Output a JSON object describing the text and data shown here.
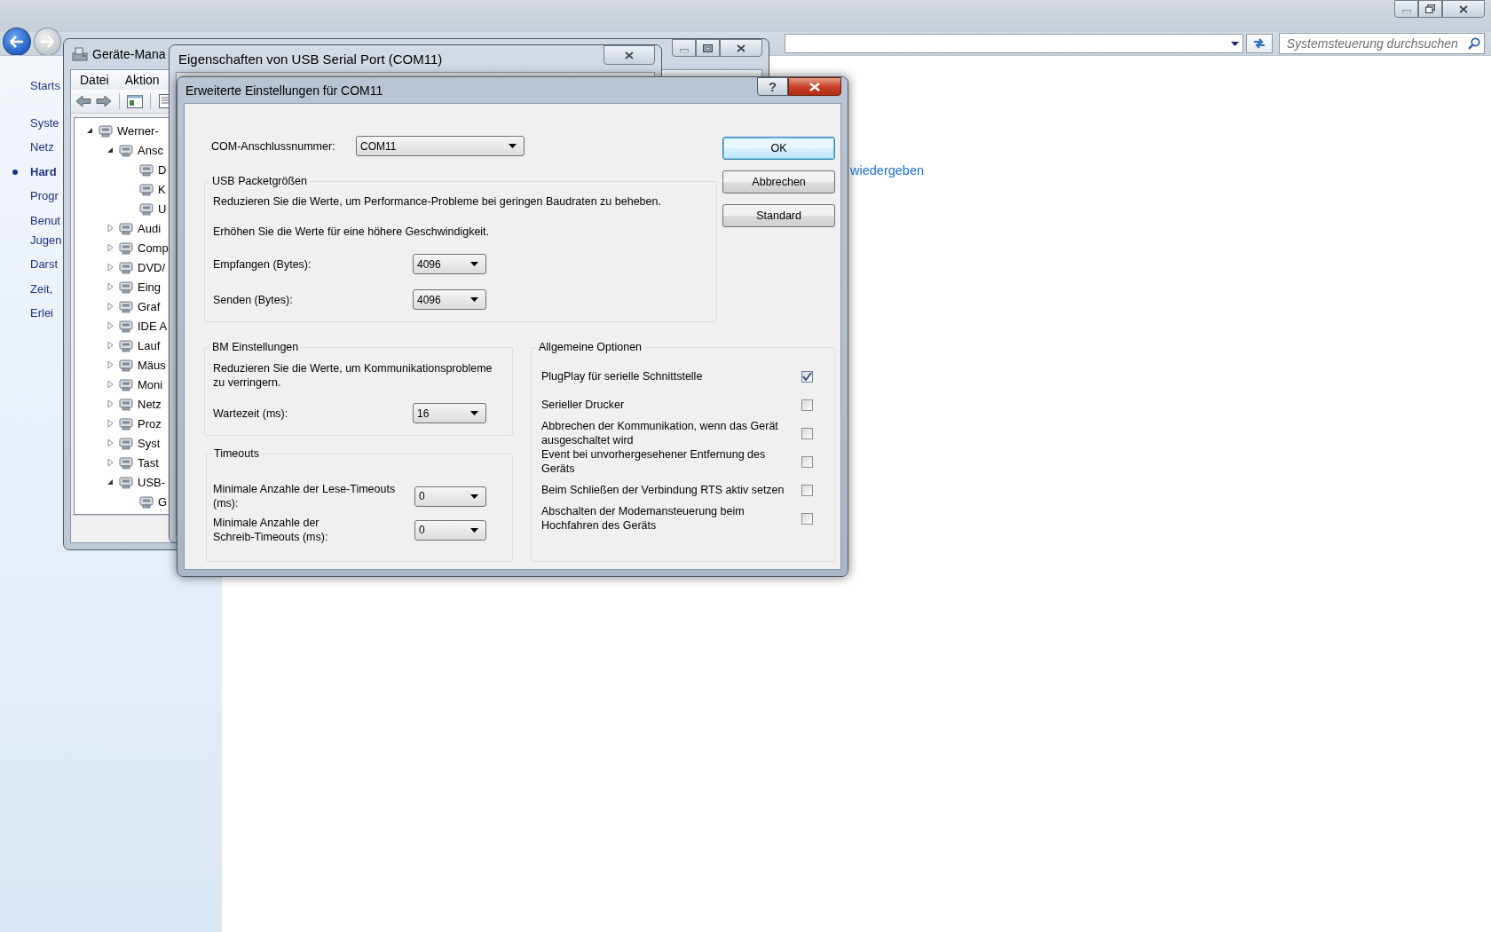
{
  "explorer": {
    "search": {
      "placeholder": "Systemsteuerung durchsuchen"
    },
    "nav_items": [
      {
        "lines": [
          "Starts"
        ],
        "selected": false
      },
      {
        "lines": [
          "Syste"
        ],
        "selected": false
      },
      {
        "lines": [
          "Netz"
        ],
        "selected": false
      },
      {
        "lines": [
          "Hard"
        ],
        "selected": true
      },
      {
        "lines": [
          "Progr"
        ],
        "selected": false
      },
      {
        "lines": [
          "Benut",
          "Jugen"
        ],
        "selected": false
      },
      {
        "lines": [
          "Darst"
        ],
        "selected": false
      },
      {
        "lines": [
          "Zeit,"
        ],
        "selected": false
      },
      {
        "lines": [
          "Erlei"
        ],
        "selected": false
      }
    ],
    "link": "wiedergeben"
  },
  "device_manager": {
    "title": "Geräte-Mana",
    "menu": [
      "Datei",
      "Aktion"
    ],
    "tree": [
      {
        "label": "Werner-",
        "expanded": true,
        "children": [
          {
            "label": "Ansc",
            "expanded": true,
            "children": [
              {
                "label": "D"
              },
              {
                "label": "K"
              },
              {
                "label": "U"
              }
            ]
          },
          {
            "label": "Audi",
            "expanded": false
          },
          {
            "label": "Comp",
            "expanded": false
          },
          {
            "label": "DVD/",
            "expanded": false
          },
          {
            "label": "Eing",
            "expanded": false
          },
          {
            "label": "Graf",
            "expanded": false
          },
          {
            "label": "IDE A",
            "expanded": false
          },
          {
            "label": "Lauf",
            "expanded": false
          },
          {
            "label": "Mäus",
            "expanded": false
          },
          {
            "label": "Moni",
            "expanded": false
          },
          {
            "label": "Netz",
            "expanded": false
          },
          {
            "label": "Proz",
            "expanded": false
          },
          {
            "label": "Syst",
            "expanded": false
          },
          {
            "label": "Tast",
            "expanded": false
          },
          {
            "label": "USB-",
            "expanded": true,
            "children": [
              {
                "label": "G"
              }
            ]
          }
        ]
      }
    ]
  },
  "properties_dialog": {
    "title": "Eigenschaften von USB Serial Port (COM11)"
  },
  "advanced_dialog": {
    "title": "Erweiterte Einstellungen für COM11",
    "help": "?",
    "com_port": {
      "label": "COM-Anschlussnummer:",
      "value": "COM11"
    },
    "buttons": [
      {
        "label": "OK",
        "default": true
      },
      {
        "label": "Abbrechen",
        "default": false
      },
      {
        "label": "Standard",
        "default": false
      }
    ],
    "usb_packet_sizes": {
      "title": "USB Packetgrößen",
      "notes": [
        "Reduzieren Sie die Werte, um Performance-Probleme bei geringen Baudraten zu beheben.",
        "Erhöhen Sie die Werte für eine höhere Geschwindigkeit."
      ],
      "fields": [
        {
          "lines": [
            "Empfangen (Bytes):"
          ],
          "value": "4096"
        },
        {
          "lines": [
            "Senden (Bytes):"
          ],
          "value": "4096"
        }
      ]
    },
    "bm_settings": {
      "title": "BM Einstellungen",
      "note": [
        "Reduzieren Sie die Werte, um Kommunikationsprobleme",
        "zu verringern."
      ],
      "fields": [
        {
          "lines": [
            "Wartezeit (ms):"
          ],
          "value": "16"
        }
      ]
    },
    "timeouts": {
      "title": "Timeouts",
      "fields": [
        {
          "lines": [
            "Minimale Anzahle der Lese-Timeouts",
            "(ms):"
          ],
          "value": "0"
        },
        {
          "lines": [
            "Minimale Anzahle der",
            "Schreib-Timeouts (ms):"
          ],
          "value": "0"
        }
      ]
    },
    "general_options": {
      "title": "Allgemeine Optionen",
      "options": [
        {
          "lines": [
            "PlugPlay für serielle Schnittstelle"
          ],
          "checked": true
        },
        {
          "lines": [
            "Serieller Drucker"
          ],
          "checked": false
        },
        {
          "lines": [
            "Abbrechen der Kommunikation, wenn das Gerät",
            "ausgeschaltet wird"
          ],
          "checked": false
        },
        {
          "lines": [
            "Event bei unvorhergesehener Entfernung des",
            "Geräts"
          ],
          "checked": false
        },
        {
          "lines": [
            "Beim Schließen der Verbindung RTS aktiv setzen"
          ],
          "checked": false
        },
        {
          "lines": [
            "Abschalten der Modemansteuerung beim",
            "Hochfahren des Geräts"
          ],
          "checked": false
        }
      ]
    }
  }
}
